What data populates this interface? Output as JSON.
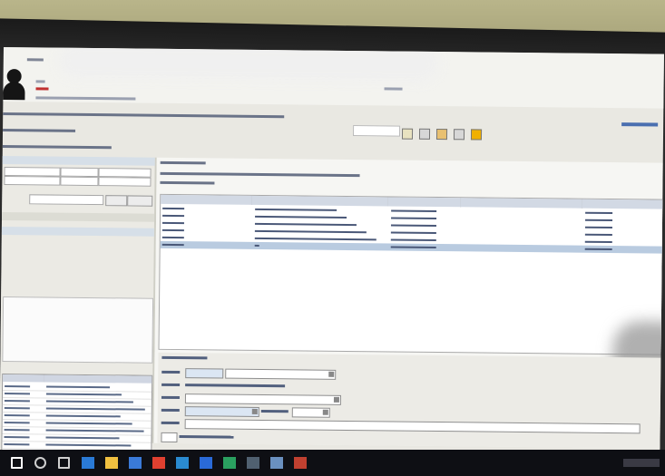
{
  "app": {
    "title": "",
    "photo_note": ""
  },
  "taskbar": {
    "icons": [
      "windows-start-icon",
      "search-icon",
      "task-view-icon",
      "edge-icon",
      "file-explorer-icon",
      "store-icon",
      "chrome-icon",
      "photos-icon",
      "app-blue-icon",
      "app-green-icon",
      "app-dark-icon",
      "app-photo-icon",
      "app-red-icon"
    ]
  },
  "colors": {
    "header_bg": "#f3f3ef",
    "panel_bg": "#ebeae4",
    "grid_header": "#d2d9e4",
    "selected_row": "#b9cbe0",
    "taskbar": "#0e0f14",
    "accent_red": "#c03030"
  }
}
